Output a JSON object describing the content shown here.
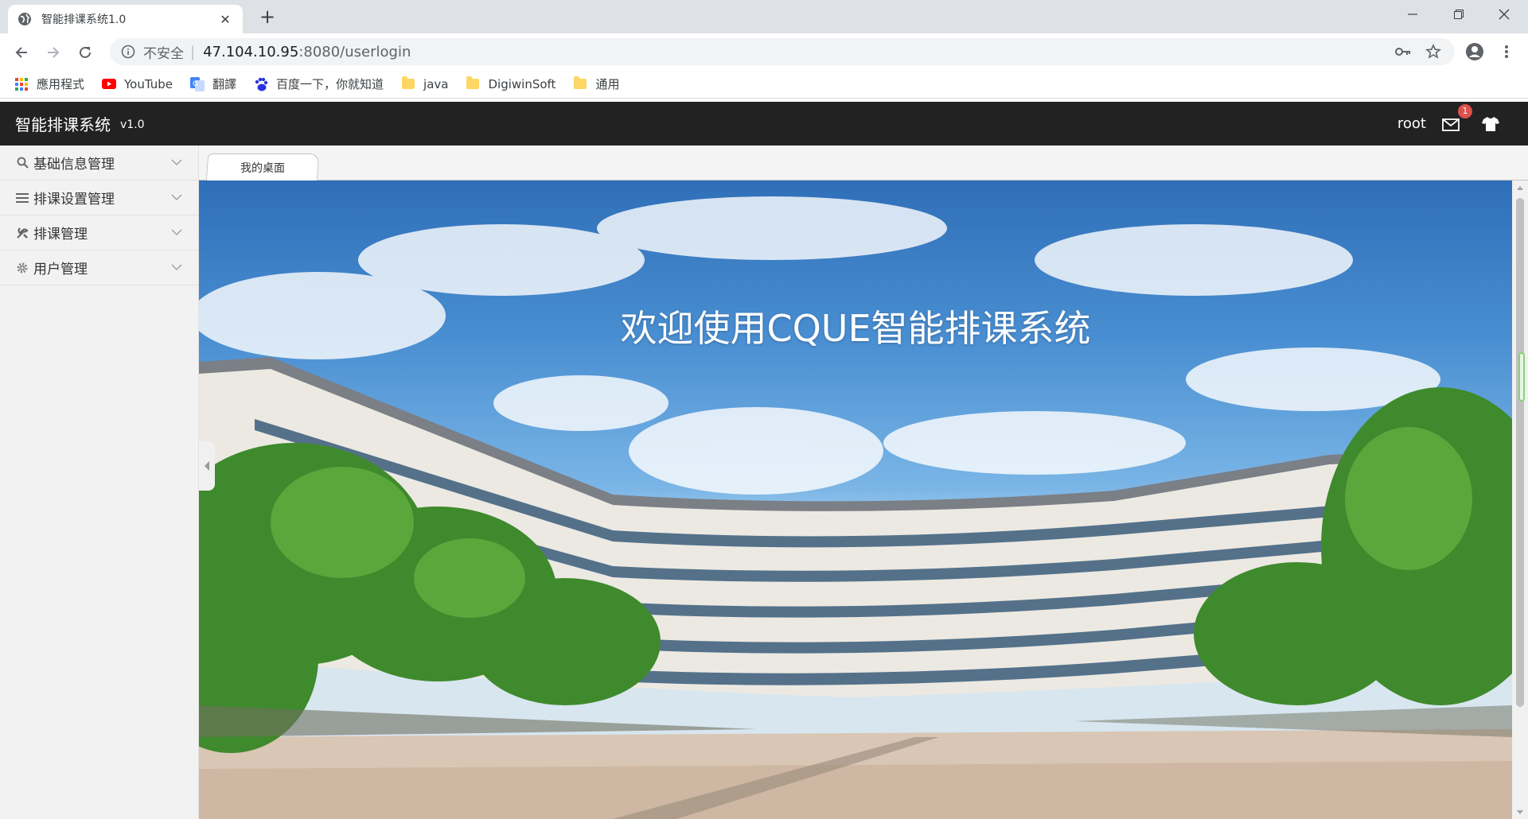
{
  "browser": {
    "tab_title": "智能排课系统1.0",
    "security_label": "不安全",
    "url_host": "47.104.10.95",
    "url_path": ":8080/userlogin",
    "bookmarks": [
      {
        "label": "應用程式",
        "icon": "apps-grid-icon"
      },
      {
        "label": "YouTube",
        "icon": "youtube-icon"
      },
      {
        "label": "翻譯",
        "icon": "translate-icon"
      },
      {
        "label": "百度一下，你就知道",
        "icon": "baidu-icon"
      },
      {
        "label": "java",
        "icon": "folder-icon"
      },
      {
        "label": "DigiwinSoft",
        "icon": "folder-icon"
      },
      {
        "label": "通用",
        "icon": "folder-icon"
      }
    ]
  },
  "header": {
    "logo": "智能排课系统",
    "version": "v1.0",
    "user": "root",
    "message_count": "1"
  },
  "sidebar": {
    "items": [
      {
        "label": "基础信息管理",
        "icon": "search-icon"
      },
      {
        "label": "排课设置管理",
        "icon": "list-icon"
      },
      {
        "label": "排课管理",
        "icon": "wrench-icon"
      },
      {
        "label": "用户管理",
        "icon": "gear-icon"
      }
    ]
  },
  "content": {
    "active_tab": "我的桌面",
    "welcome": "欢迎使用CQUE智能排课系统"
  },
  "colors": {
    "header_bg": "#222222",
    "badge": "#dd514c",
    "sidebar_bg": "#f2f2f2"
  }
}
